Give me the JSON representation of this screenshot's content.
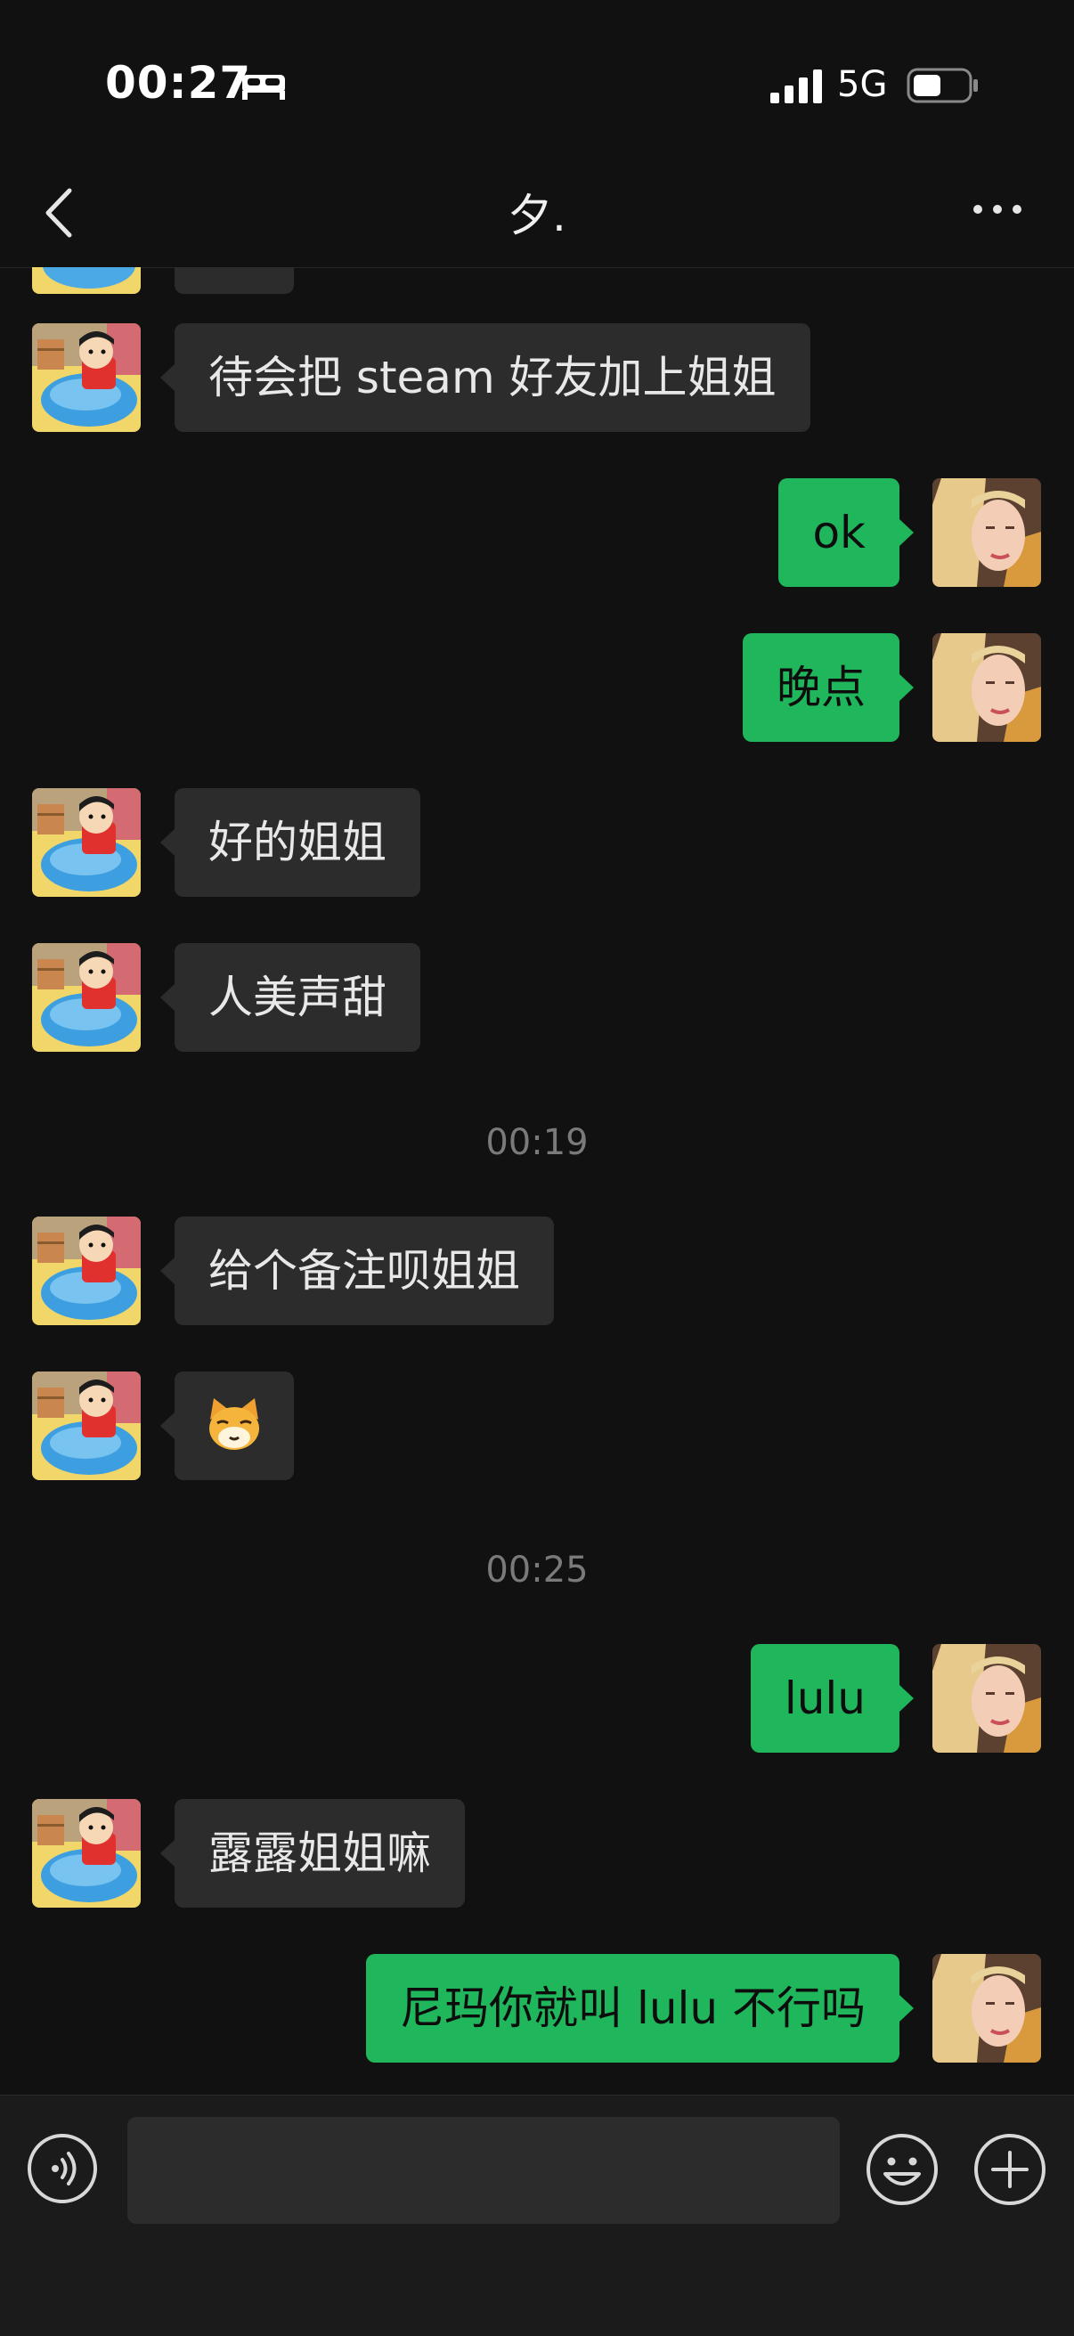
{
  "status_bar": {
    "time": "00:27",
    "network": "5G",
    "sleep_icon": "bed-icon",
    "signal_icon": "signal-bars-icon",
    "battery_icon": "battery-icon"
  },
  "nav": {
    "title": "夕.",
    "back_icon": "chevron-left-icon",
    "more_icon": "more-dots-icon"
  },
  "messages": [
    {
      "side": "in",
      "text": "待会把 steam 好友加上姐姐"
    },
    {
      "side": "out",
      "text": "ok"
    },
    {
      "side": "out",
      "text": "晚点"
    },
    {
      "side": "in",
      "text": "好的姐姐"
    },
    {
      "side": "in",
      "text": "人美声甜"
    },
    {
      "type": "time",
      "text": "00:19"
    },
    {
      "side": "in",
      "text": "给个备注呗姐姐"
    },
    {
      "side": "in",
      "text": "🐱",
      "emoji": "cat-face-emoji"
    },
    {
      "type": "time",
      "text": "00:25"
    },
    {
      "side": "out",
      "text": "lulu"
    },
    {
      "side": "in",
      "text": "露露姐姐嘛"
    },
    {
      "side": "out",
      "text": "尼玛你就叫 lulu 不行吗"
    }
  ],
  "input_bar": {
    "value": "",
    "voice_icon": "voice-icon",
    "emoji_icon": "smiley-icon",
    "plus_icon": "plus-icon"
  },
  "colors": {
    "background": "#111111",
    "incoming_bubble": "#2c2c2c",
    "outgoing_bubble": "#1fb65c",
    "input_bar": "#1b1b1b"
  }
}
